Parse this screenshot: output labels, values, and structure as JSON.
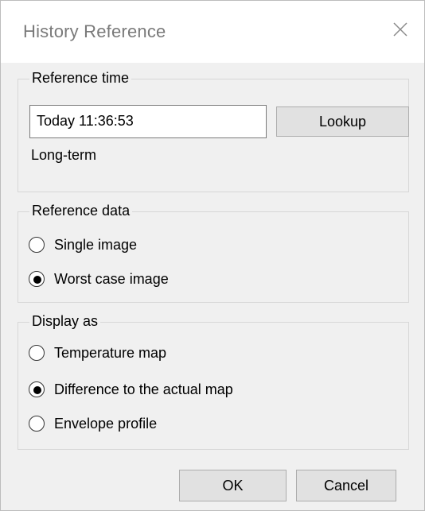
{
  "dialog": {
    "title": "History Reference"
  },
  "reference_time": {
    "group_label": "Reference time",
    "time_value": "Today 11:36:53",
    "lookup_label": "Lookup",
    "mode_text": "Long-term"
  },
  "reference_data": {
    "group_label": "Reference data",
    "options": [
      {
        "label": "Single image",
        "selected": false
      },
      {
        "label": "Worst case image",
        "selected": true
      }
    ]
  },
  "display_as": {
    "group_label": "Display as",
    "options": [
      {
        "label": "Temperature map",
        "selected": false
      },
      {
        "label": "Difference to the actual map",
        "selected": true
      },
      {
        "label": "Envelope profile",
        "selected": false
      }
    ]
  },
  "buttons": {
    "ok_label": "OK",
    "cancel_label": "Cancel"
  },
  "icons": {
    "close": "close-icon"
  }
}
